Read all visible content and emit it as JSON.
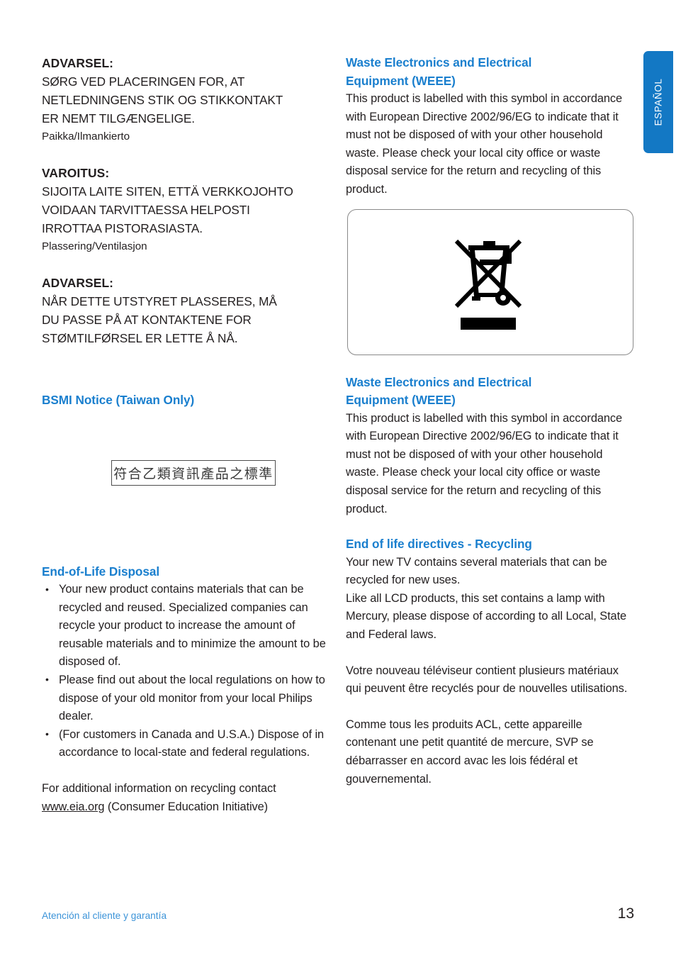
{
  "language_tab": {
    "label": "ESPAÑOL"
  },
  "left_column": {
    "notices": [
      {
        "title": "ADVARSEL:",
        "lines": [
          "SØRG VED PLACERINGEN FOR, AT",
          "NETLEDNINGENS STIK OG STIKKONTAKT",
          "ER NEMT TILGÆNGELIGE."
        ],
        "subline": "Paikka/Ilmankierto"
      },
      {
        "title": "VAROITUS:",
        "lines": [
          "SIJOITA LAITE SITEN, ETTÄ VERKKOJOHTO",
          "VOIDAAN TARVITTAESSA HELPOSTI",
          "IRROTTAA PISTORASIASTA."
        ],
        "subline": "Plassering/Ventilasjon"
      },
      {
        "title": "ADVARSEL:",
        "lines": [
          "NÅR DETTE UTSTYRET PLASSERES, MÅ",
          "DU PASSE PÅ AT KONTAKTENE FOR",
          "STØMTILFØRSEL ER LETTE Å NÅ."
        ],
        "subline": ""
      }
    ],
    "bsmi": {
      "heading": "BSMI Notice (Taiwan Only)",
      "mark_text": "符合乙類資訊產品之標準"
    },
    "end_of_life": {
      "heading": "End-of-Life Disposal",
      "bullets": [
        "Your new product contains materials that can be recycled and reused. Specialized companies can recycle your product to increase the amount of reusable materials and to minimize the amount to be disposed of.",
        "Please find out about the local regulations on how to dispose of your old monitor from your local Philips dealer.",
        "(For customers in Canada and U.S.A.) Dispose of in accordance to local-state and federal regulations."
      ],
      "closing_prefix": "For additional information on recycling contact ",
      "closing_link": "www.eia.org",
      "closing_suffix": " (Consumer Education Initiative)"
    }
  },
  "right_column": {
    "weee_first": {
      "heading_line1": "Waste Electronics and Electrical",
      "heading_line2": "Equipment (WEEE)",
      "body": "This product is labelled with this symbol in accordance with European Directive 2002/96/EG to indicate that it must not be disposed of with your other household waste. Please check your local city office or waste disposal service for the return and recycling of this product."
    },
    "weee_symbol": {
      "name": "crossed-out-wheeled-bin",
      "description": "Crossed-out wheeled bin with solid bar beneath"
    },
    "weee_second": {
      "heading_line1": "Waste Electronics and Electrical",
      "heading_line2": "Equipment (WEEE)",
      "body": "This product is labelled with this symbol in accordance with European Directive 2002/96/EG to indicate that it must not be disposed of with your other household waste. Please check your local city office or waste disposal service for the return and recycling of this product."
    },
    "recycling": {
      "heading": "End of life directives - Recycling",
      "paragraph1": "Your new TV contains several materials that can be recycled for new uses.",
      "paragraph2": "Like all LCD products, this set contains a lamp with Mercury, please dispose of according to all Local, State and Federal laws.",
      "paragraph3": "Votre nouveau téléviseur contient plusieurs matériaux qui peuvent être recyclés pour de nouvelles utilisations.",
      "paragraph4": "Comme tous les produits ACL, cette appareille contenant une petit quantité de mercure, SVP se débarrasser en accord avac les lois fédéral et gouvernemental."
    }
  },
  "footer": {
    "section_label": "Atención al cliente y garantía",
    "page_number": "13"
  },
  "colors": {
    "heading_blue": "#1a7fce",
    "tab_blue": "#1378c4",
    "footer_blue": "#3b93d8",
    "text_black": "#231f20"
  }
}
